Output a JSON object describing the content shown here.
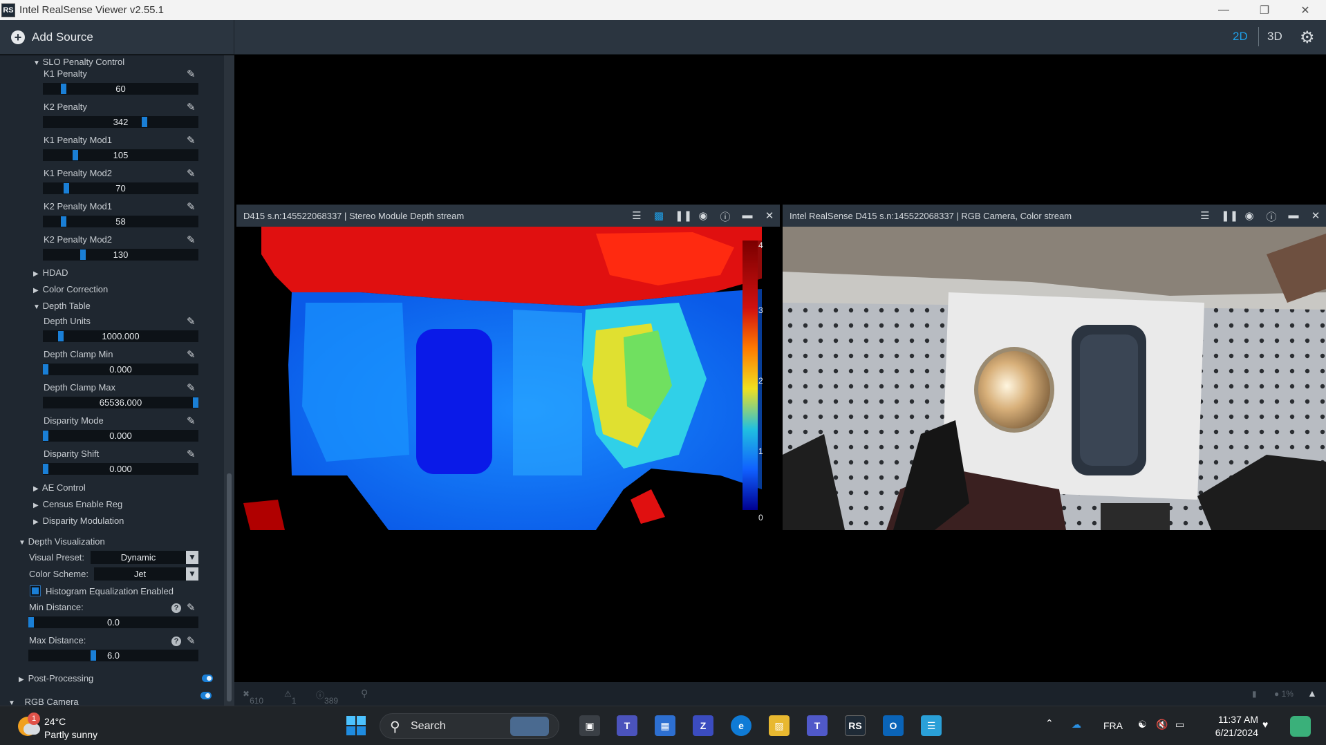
{
  "window": {
    "title": "Intel RealSense Viewer v2.55.1",
    "app_icon": "RS"
  },
  "toolbar": {
    "add_source": "Add Source",
    "mode_2d": "2D",
    "mode_3d": "3D",
    "accent": "#1fa0e8"
  },
  "sidebar": {
    "slo_section": "SLO Penalty Control",
    "k1_penalty": {
      "label": "K1 Penalty",
      "value": "60",
      "level": 0.12
    },
    "k2_penalty": {
      "label": "K2 Penalty",
      "value": "342",
      "level": 0.66
    },
    "k1_mod1": {
      "label": "K1 Penalty Mod1",
      "value": "105",
      "level": 0.2
    },
    "k1_mod2": {
      "label": "K1 Penalty Mod2",
      "value": "70",
      "level": 0.14
    },
    "k2_mod1": {
      "label": "K2 Penalty Mod1",
      "value": "58",
      "level": 0.12
    },
    "k2_mod2": {
      "label": "K2 Penalty Mod2",
      "value": "130",
      "level": 0.25
    },
    "hdad": "HDAD",
    "color_correction": "Color Correction",
    "depth_table": "Depth Table",
    "depth_units": {
      "label": "Depth Units",
      "value": "1000.000",
      "level": 0.1
    },
    "depth_clamp_min": {
      "label": "Depth Clamp Min",
      "value": "0.000",
      "level": 0.0
    },
    "depth_clamp_max": {
      "label": "Depth Clamp Max",
      "value": "65536.000",
      "level": 1.0
    },
    "disparity_mode": {
      "label": "Disparity Mode",
      "value": "0.000",
      "level": 0.0
    },
    "disparity_shift": {
      "label": "Disparity Shift",
      "value": "0.000",
      "level": 0.0
    },
    "ae_control": "AE Control",
    "census_enable_reg": "Census Enable Reg",
    "disparity_modulation": "Disparity Modulation",
    "depth_visualization": "Depth Visualization",
    "visual_preset_label": "Visual Preset:",
    "visual_preset_value": "Dynamic",
    "color_scheme_label": "Color Scheme:",
    "color_scheme_value": "Jet",
    "histogram_eq": "Histogram Equalization Enabled",
    "min_distance": {
      "label": "Min Distance:",
      "value": "0.0",
      "level": 0.0
    },
    "max_distance": {
      "label": "Max Distance:",
      "value": "6.0",
      "level": 0.38
    },
    "post_processing": "Post-Processing",
    "rgb_camera": "RGB Camera"
  },
  "depth_panel": {
    "title": "D415 s.n:145522068337 | Stereo Module Depth stream",
    "scale_labels": [
      "4",
      "3",
      "2",
      "1",
      "0"
    ]
  },
  "color_panel": {
    "title": "Intel RealSense D415 s.n:145522068337 | RGB Camera, Color stream"
  },
  "statusbar": {
    "errors": "610",
    "warnings": "1",
    "info": "389"
  },
  "taskbar": {
    "weather_temp": "24°C",
    "weather_cond": "Partly sunny",
    "weather_badge": "1",
    "search": "Search",
    "rs_icon": "RS",
    "language": "FRA",
    "time": "11:37 AM",
    "date": "6/21/2024"
  }
}
